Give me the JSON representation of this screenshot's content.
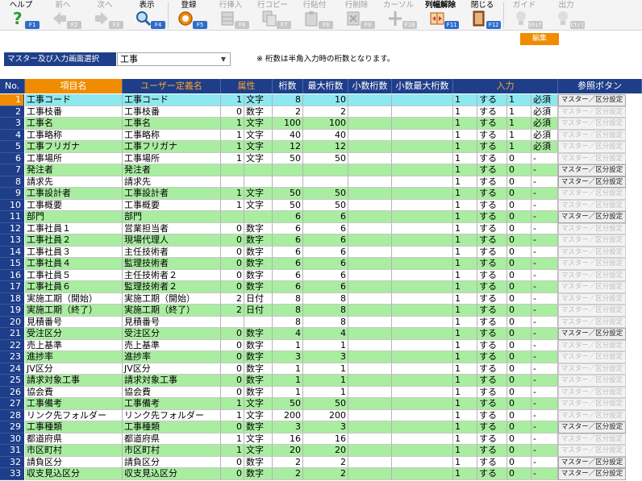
{
  "toolbar": {
    "buttons": [
      {
        "label": "ヘルプ",
        "fkey": "F1",
        "icon": "help-icon",
        "state": "on"
      },
      {
        "label": "前へ",
        "fkey": "F2",
        "icon": "arrow-left-icon",
        "state": "off"
      },
      {
        "label": "次へ",
        "fkey": "F3",
        "icon": "arrow-right-icon",
        "state": "off"
      },
      {
        "label": "表示",
        "fkey": "F4",
        "icon": "search-icon",
        "state": "on"
      },
      {
        "label": "登録",
        "fkey": "F5",
        "icon": "save-icon",
        "state": "on"
      },
      {
        "label": "行挿入",
        "fkey": "F6",
        "icon": "insert-row-icon",
        "state": "off"
      },
      {
        "label": "行コピー",
        "fkey": "F7",
        "icon": "copy-row-icon",
        "state": "off"
      },
      {
        "label": "行貼付",
        "fkey": "F8",
        "icon": "paste-row-icon",
        "state": "off"
      },
      {
        "label": "行削除",
        "fkey": "F9",
        "icon": "delete-row-icon",
        "state": "off"
      },
      {
        "label": "カーソル",
        "fkey": "F10",
        "icon": "cursor-icon",
        "state": "off"
      },
      {
        "label": "列幅解除",
        "fkey": "F11",
        "icon": "column-width-icon",
        "state": "on"
      },
      {
        "label": "閉じる",
        "fkey": "F12",
        "icon": "close-icon",
        "state": "on"
      },
      {
        "label": "ガイド",
        "fkey": "Shift1",
        "icon": "guide-icon",
        "state": "off"
      },
      {
        "label": "出力",
        "fkey": "Ctrl P",
        "icon": "output-icon",
        "state": "off"
      }
    ],
    "edit_tab": "編集"
  },
  "selector": {
    "label": "マスター及び入力画面選択",
    "value": "工事",
    "note": "※ 桁数は半角入力時の桁数となります。"
  },
  "headers": [
    "No.",
    "項目名",
    "ユーザー定義名",
    "属性",
    "",
    "桁数",
    "最大桁数",
    "小数桁数",
    "小数最大桁数",
    "入力",
    "参照ボタン"
  ],
  "ref_button_label": "マスター／区分設定",
  "colors": {
    "header_bg": "#1f3e8a",
    "highlight_orange": "#f08c00",
    "row_green": "#a9eda0",
    "row_white": "#ffffff",
    "selected_cyan": "#8ee8ef",
    "fkey_blue": "#2f6cc9"
  },
  "rows": [
    {
      "no": "1",
      "name": "工事コード",
      "user": "工事コード",
      "attr": "1",
      "type": "文字",
      "digits": "8",
      "max": "10",
      "dec": "",
      "decmax": "",
      "in1": "1",
      "in2": "する",
      "in3": "1",
      "req": "必須",
      "btn": true
    },
    {
      "no": "2",
      "name": "工事枝番",
      "user": "工事枝番",
      "attr": "0",
      "type": "数字",
      "digits": "2",
      "max": "2",
      "dec": "",
      "decmax": "",
      "in1": "1",
      "in2": "する",
      "in3": "1",
      "req": "必須",
      "btn": false
    },
    {
      "no": "3",
      "name": "工事名",
      "user": "工事名",
      "attr": "1",
      "type": "文字",
      "digits": "100",
      "max": "100",
      "dec": "",
      "decmax": "",
      "in1": "1",
      "in2": "する",
      "in3": "1",
      "req": "必須",
      "btn": false
    },
    {
      "no": "4",
      "name": "工事略称",
      "user": "工事略称",
      "attr": "1",
      "type": "文字",
      "digits": "40",
      "max": "40",
      "dec": "",
      "decmax": "",
      "in1": "1",
      "in2": "する",
      "in3": "1",
      "req": "必須",
      "btn": false
    },
    {
      "no": "5",
      "name": "工事フリガナ",
      "user": "工事フリガナ",
      "attr": "1",
      "type": "文字",
      "digits": "12",
      "max": "12",
      "dec": "",
      "decmax": "",
      "in1": "1",
      "in2": "する",
      "in3": "1",
      "req": "必須",
      "btn": false
    },
    {
      "no": "6",
      "name": "工事場所",
      "user": "工事場所",
      "attr": "1",
      "type": "文字",
      "digits": "50",
      "max": "50",
      "dec": "",
      "decmax": "",
      "in1": "1",
      "in2": "する",
      "in3": "0",
      "req": "-",
      "btn": false
    },
    {
      "no": "7",
      "name": "発注者",
      "user": "発注者",
      "attr": "",
      "type": "",
      "digits": "",
      "max": "",
      "dec": "",
      "decmax": "",
      "in1": "1",
      "in2": "する",
      "in3": "0",
      "req": "-",
      "btn": true
    },
    {
      "no": "8",
      "name": "請求先",
      "user": "請求先",
      "attr": "",
      "type": "",
      "digits": "",
      "max": "",
      "dec": "",
      "decmax": "",
      "in1": "1",
      "in2": "する",
      "in3": "0",
      "req": "-",
      "btn": true
    },
    {
      "no": "9",
      "name": "工事設計者",
      "user": "工事設計者",
      "attr": "1",
      "type": "文字",
      "digits": "50",
      "max": "50",
      "dec": "",
      "decmax": "",
      "in1": "1",
      "in2": "する",
      "in3": "0",
      "req": "-",
      "btn": false
    },
    {
      "no": "10",
      "name": "工事概要",
      "user": "工事概要",
      "attr": "1",
      "type": "文字",
      "digits": "50",
      "max": "50",
      "dec": "",
      "decmax": "",
      "in1": "1",
      "in2": "する",
      "in3": "0",
      "req": "-",
      "btn": false
    },
    {
      "no": "11",
      "name": "部門",
      "user": "部門",
      "attr": "",
      "type": "",
      "digits": "6",
      "max": "6",
      "dec": "",
      "decmax": "",
      "in1": "1",
      "in2": "する",
      "in3": "0",
      "req": "-",
      "btn": true
    },
    {
      "no": "12",
      "name": "工事社員１",
      "user": "営業担当者",
      "attr": "0",
      "type": "数字",
      "digits": "6",
      "max": "6",
      "dec": "",
      "decmax": "",
      "in1": "1",
      "in2": "する",
      "in3": "0",
      "req": "-",
      "btn": false
    },
    {
      "no": "13",
      "name": "工事社員２",
      "user": "現場代理人",
      "attr": "0",
      "type": "数字",
      "digits": "6",
      "max": "6",
      "dec": "",
      "decmax": "",
      "in1": "1",
      "in2": "する",
      "in3": "0",
      "req": "-",
      "btn": false
    },
    {
      "no": "14",
      "name": "工事社員３",
      "user": "主任技術者",
      "attr": "0",
      "type": "数字",
      "digits": "6",
      "max": "6",
      "dec": "",
      "decmax": "",
      "in1": "1",
      "in2": "する",
      "in3": "0",
      "req": "-",
      "btn": false
    },
    {
      "no": "15",
      "name": "工事社員４",
      "user": "監理技術者",
      "attr": "0",
      "type": "数字",
      "digits": "6",
      "max": "6",
      "dec": "",
      "decmax": "",
      "in1": "1",
      "in2": "する",
      "in3": "0",
      "req": "-",
      "btn": false
    },
    {
      "no": "16",
      "name": "工事社員５",
      "user": "主任技術者２",
      "attr": "0",
      "type": "数字",
      "digits": "6",
      "max": "6",
      "dec": "",
      "decmax": "",
      "in1": "1",
      "in2": "する",
      "in3": "0",
      "req": "-",
      "btn": false
    },
    {
      "no": "17",
      "name": "工事社員６",
      "user": "監理技術者２",
      "attr": "0",
      "type": "数字",
      "digits": "6",
      "max": "6",
      "dec": "",
      "decmax": "",
      "in1": "1",
      "in2": "する",
      "in3": "0",
      "req": "-",
      "btn": false
    },
    {
      "no": "18",
      "name": "実施工期（開始）",
      "user": "実施工期（開始）",
      "attr": "2",
      "type": "日付",
      "digits": "8",
      "max": "8",
      "dec": "",
      "decmax": "",
      "in1": "1",
      "in2": "する",
      "in3": "0",
      "req": "-",
      "btn": false
    },
    {
      "no": "19",
      "name": "実施工期（終了）",
      "user": "実施工期（終了）",
      "attr": "2",
      "type": "日付",
      "digits": "8",
      "max": "8",
      "dec": "",
      "decmax": "",
      "in1": "1",
      "in2": "する",
      "in3": "0",
      "req": "-",
      "btn": false
    },
    {
      "no": "20",
      "name": "見積番号",
      "user": "見積番号",
      "attr": "",
      "type": "",
      "digits": "8",
      "max": "8",
      "dec": "",
      "decmax": "",
      "in1": "1",
      "in2": "する",
      "in3": "0",
      "req": "-",
      "btn": false
    },
    {
      "no": "21",
      "name": "受注区分",
      "user": "受注区分",
      "attr": "0",
      "type": "数字",
      "digits": "4",
      "max": "4",
      "dec": "",
      "decmax": "",
      "in1": "1",
      "in2": "する",
      "in3": "0",
      "req": "-",
      "btn": true
    },
    {
      "no": "22",
      "name": "売上基準",
      "user": "売上基準",
      "attr": "0",
      "type": "数字",
      "digits": "1",
      "max": "1",
      "dec": "",
      "decmax": "",
      "in1": "1",
      "in2": "する",
      "in3": "0",
      "req": "-",
      "btn": false
    },
    {
      "no": "23",
      "name": "進捗率",
      "user": "進捗率",
      "attr": "0",
      "type": "数字",
      "digits": "3",
      "max": "3",
      "dec": "",
      "decmax": "",
      "in1": "1",
      "in2": "する",
      "in3": "0",
      "req": "-",
      "btn": false
    },
    {
      "no": "24",
      "name": "JV区分",
      "user": "JV区分",
      "attr": "0",
      "type": "数字",
      "digits": "1",
      "max": "1",
      "dec": "",
      "decmax": "",
      "in1": "1",
      "in2": "する",
      "in3": "0",
      "req": "-",
      "btn": false
    },
    {
      "no": "25",
      "name": "請求対象工事",
      "user": "請求対象工事",
      "attr": "0",
      "type": "数字",
      "digits": "1",
      "max": "1",
      "dec": "",
      "decmax": "",
      "in1": "1",
      "in2": "する",
      "in3": "0",
      "req": "-",
      "btn": false
    },
    {
      "no": "26",
      "name": "協会費",
      "user": "協会費",
      "attr": "0",
      "type": "数字",
      "digits": "1",
      "max": "1",
      "dec": "",
      "decmax": "",
      "in1": "1",
      "in2": "する",
      "in3": "0",
      "req": "-",
      "btn": false
    },
    {
      "no": "27",
      "name": "工事備考",
      "user": "工事備考",
      "attr": "1",
      "type": "文字",
      "digits": "50",
      "max": "50",
      "dec": "",
      "decmax": "",
      "in1": "1",
      "in2": "する",
      "in3": "0",
      "req": "-",
      "btn": false
    },
    {
      "no": "28",
      "name": "リンク先フォルダー",
      "user": "リンク先フォルダー",
      "attr": "1",
      "type": "文字",
      "digits": "200",
      "max": "200",
      "dec": "",
      "decmax": "",
      "in1": "1",
      "in2": "する",
      "in3": "0",
      "req": "-",
      "btn": false
    },
    {
      "no": "29",
      "name": "工事種類",
      "user": "工事種類",
      "attr": "0",
      "type": "数字",
      "digits": "3",
      "max": "3",
      "dec": "",
      "decmax": "",
      "in1": "1",
      "in2": "する",
      "in3": "0",
      "req": "-",
      "btn": true
    },
    {
      "no": "30",
      "name": "都道府県",
      "user": "都道府県",
      "attr": "1",
      "type": "文字",
      "digits": "16",
      "max": "16",
      "dec": "",
      "decmax": "",
      "in1": "1",
      "in2": "する",
      "in3": "0",
      "req": "-",
      "btn": false
    },
    {
      "no": "31",
      "name": "市区町村",
      "user": "市区町村",
      "attr": "1",
      "type": "文字",
      "digits": "20",
      "max": "20",
      "dec": "",
      "decmax": "",
      "in1": "1",
      "in2": "する",
      "in3": "0",
      "req": "-",
      "btn": false
    },
    {
      "no": "32",
      "name": "請負区分",
      "user": "請負区分",
      "attr": "0",
      "type": "数字",
      "digits": "2",
      "max": "2",
      "dec": "",
      "decmax": "",
      "in1": "1",
      "in2": "する",
      "in3": "0",
      "req": "-",
      "btn": true
    },
    {
      "no": "33",
      "name": "収支見込区分",
      "user": "収支見込区分",
      "attr": "0",
      "type": "数字",
      "digits": "2",
      "max": "2",
      "dec": "",
      "decmax": "",
      "in1": "1",
      "in2": "する",
      "in3": "0",
      "req": "-",
      "btn": true
    }
  ]
}
